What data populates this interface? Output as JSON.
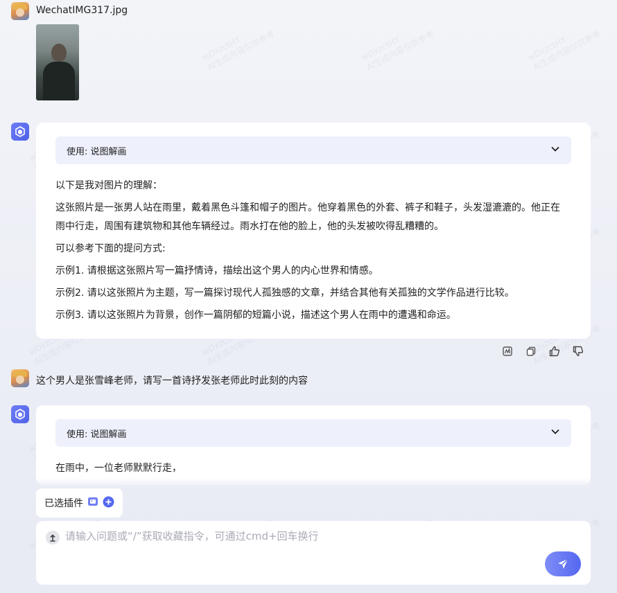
{
  "watermark": {
    "line1": "wDxzctHY",
    "line2": "AI生成内容仅供参考"
  },
  "upload": {
    "filename": "WechatIMG317.jpg"
  },
  "responses": [
    {
      "plugin_label": "使用: 说图解画",
      "paragraphs": [
        "以下是我对图片的理解：",
        "这张照片是一张男人站在雨里，戴着黑色斗篷和帽子的图片。他穿着黑色的外套、裤子和鞋子，头发湿漉漉的。他正在雨中行走，周围有建筑物和其他车辆经过。雨水打在他的脸上，他的头发被吹得乱糟糟的。",
        "可以参考下面的提问方式:",
        "示例1. 请根据这张照片写一篇抒情诗，描绘出这个男人的内心世界和情感。",
        "示例2. 请以这张照片为主题，写一篇探讨现代人孤独感的文章，并结合其他有关孤独的文学作品进行比较。",
        "示例3. 请以这张照片为背景，创作一篇阴郁的短篇小说，描述这个男人在雨中的遭遇和命运。"
      ]
    },
    {
      "plugin_label": "使用: 说图解画",
      "paragraphs": [
        "在雨中，一位老师默默行走，"
      ]
    }
  ],
  "user_question": "这个男人是张雪峰老师，请写一首诗抒发张老师此时此刻的内容",
  "plugins_bar": {
    "label": "已选插件"
  },
  "input": {
    "placeholder": "请输入问题或“/”获取收藏指令，可通过cmd+回车换行"
  },
  "colors": {
    "accent": "#5468f0",
    "plugin_bg": "#eef0fc",
    "page_bg": "#eceef6"
  }
}
